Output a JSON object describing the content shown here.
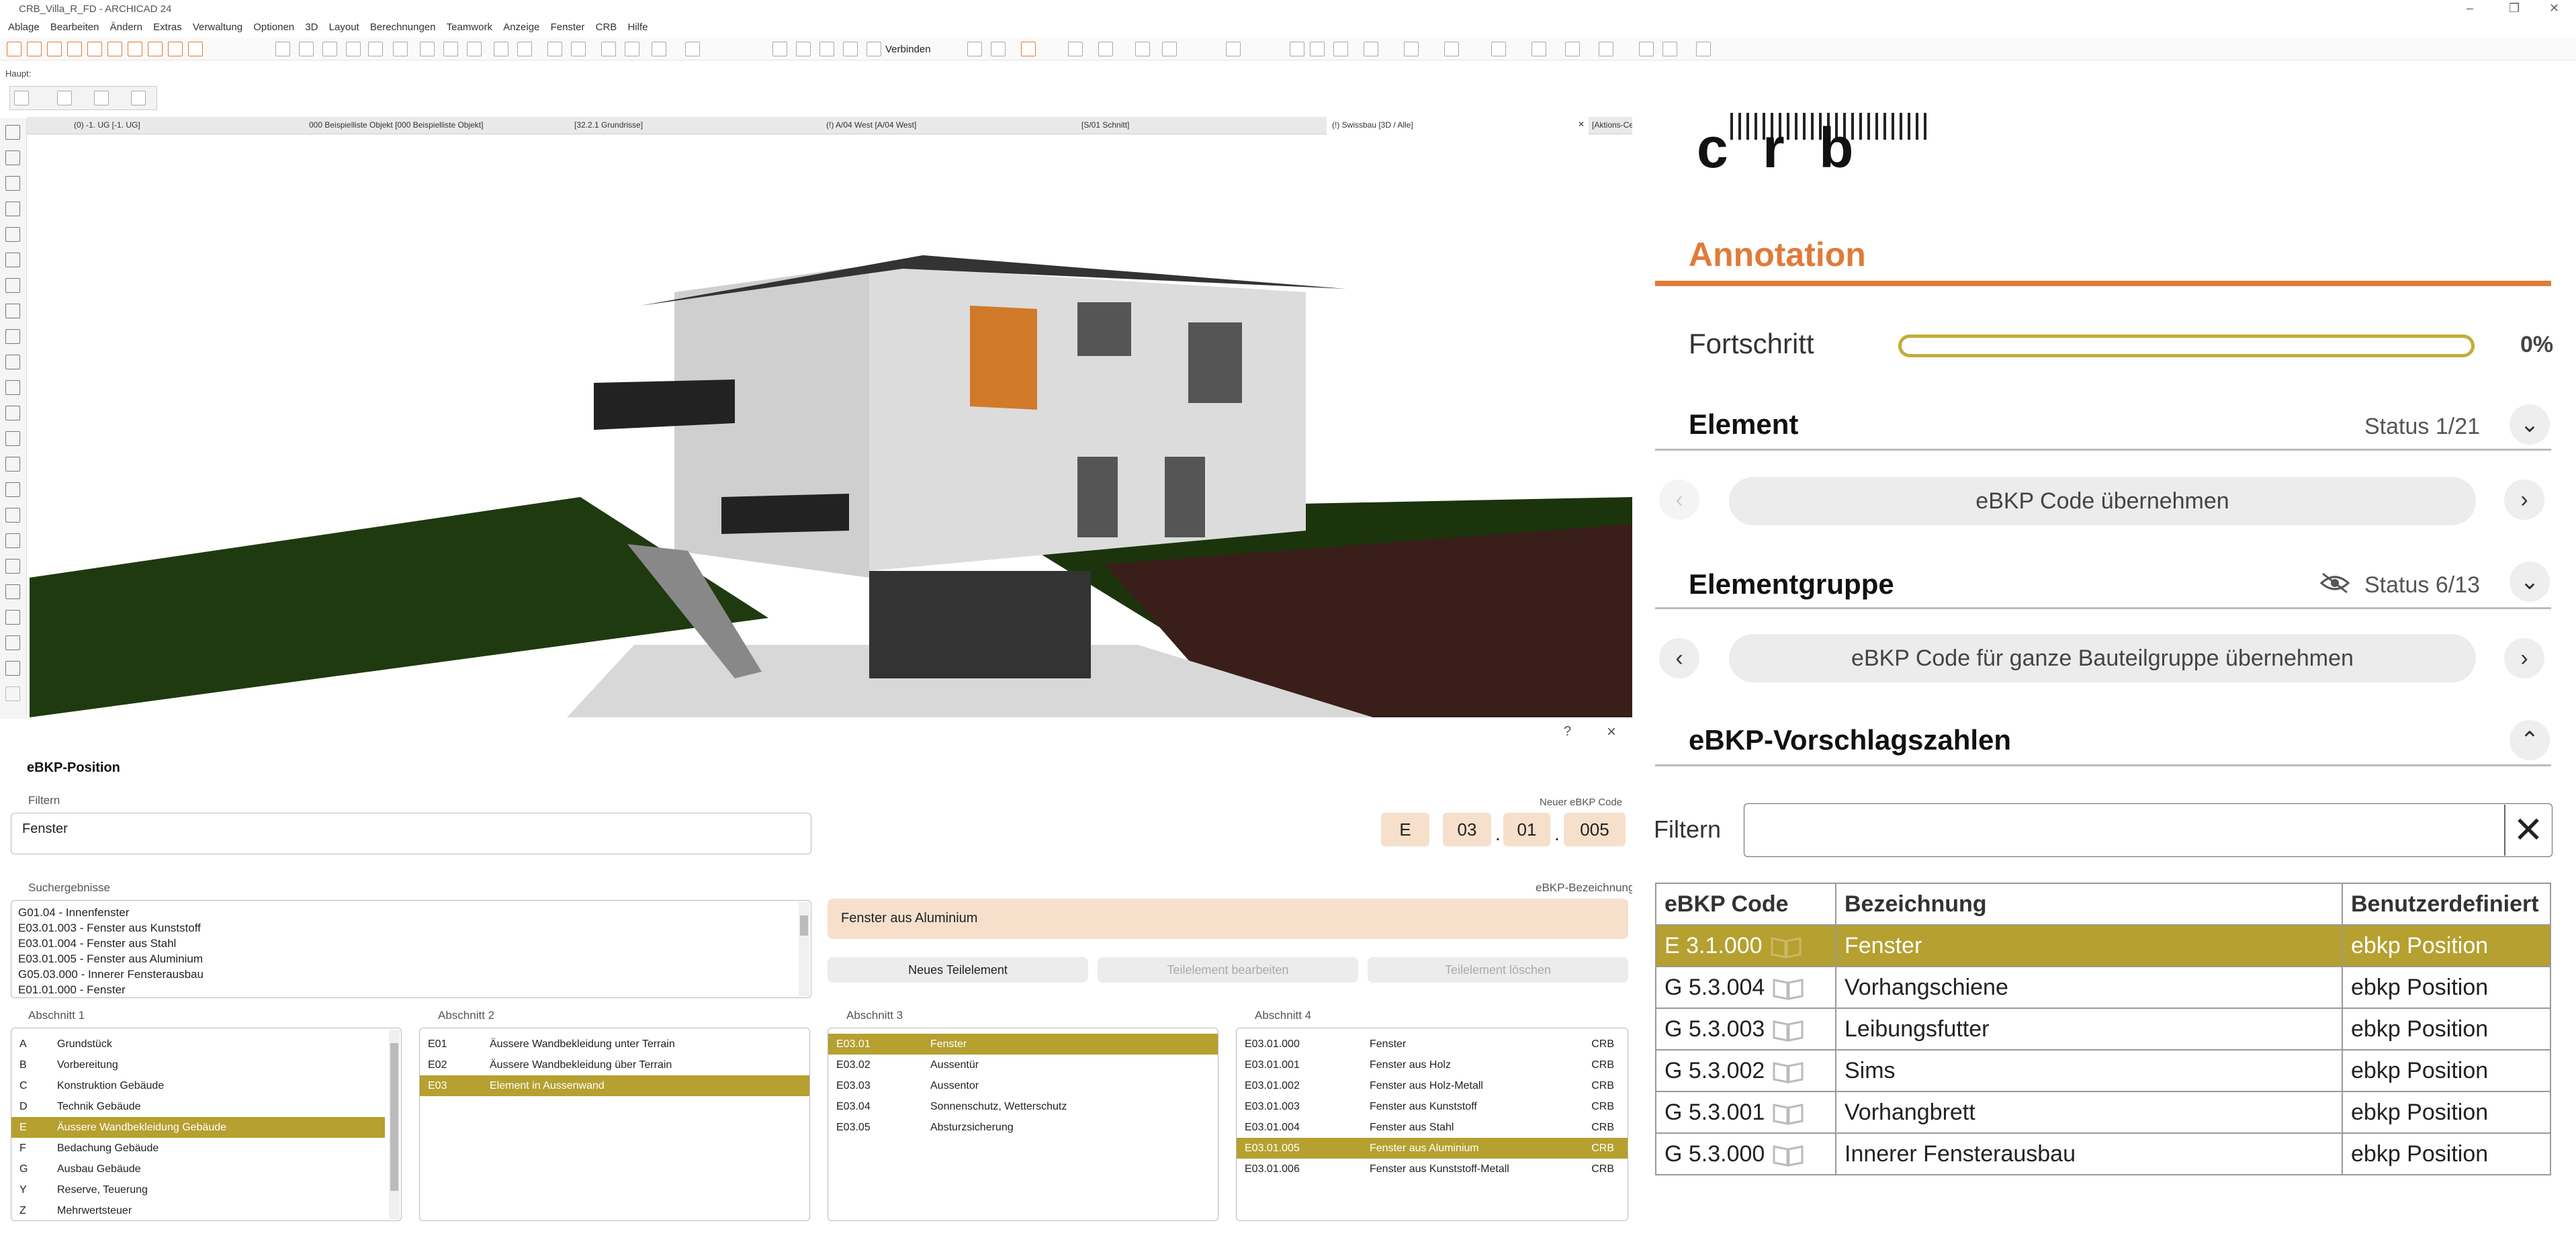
{
  "window": {
    "title": "CRB_Villa_R_FD - ARCHICAD 24"
  },
  "menu": [
    "Ablage",
    "Bearbeiten",
    "Ändern",
    "Extras",
    "Verwaltung",
    "Optionen",
    "3D",
    "Layout",
    "Berechnungen",
    "Teamwork",
    "Anzeige",
    "Fenster",
    "CRB",
    "Hilfe"
  ],
  "toolbar": {
    "verbinden_label": "Verbinden",
    "haupt_label": "Haupt:"
  },
  "tabs": [
    {
      "label": "(0) -1. UG [-1. UG]"
    },
    {
      "label": "000 Beispielliste Objekt [000 Beispielliste Objekt]"
    },
    {
      "label": "[32.2.1 Grundrisse]"
    },
    {
      "label": "(!) A/04 West [A/04 West]"
    },
    {
      "label": "[S/01 Schnitt]"
    },
    {
      "label": "(!) Swissbau [3D / Alle]"
    },
    {
      "label": "[Aktions-Cen"
    }
  ],
  "panel": {
    "help_label": "?",
    "close_label": "×",
    "title": "eBKP-Position",
    "filter_label": "Filtern",
    "filter_value": "Fenster",
    "new_code_label": "Neuer eBKP Code",
    "code": {
      "p1": "E",
      "p2": "03",
      "p3": "01",
      "p4": "005",
      "sep": "."
    },
    "results_label": "Suchergebnisse",
    "results": [
      "G01.04 - Innenfenster",
      "E03.01.003 - Fenster aus Kunststoff",
      "E03.01.004 - Fenster aus Stahl",
      "E03.01.005 - Fenster aus Aluminium",
      "G05.03.000 - Innerer Fensterausbau",
      "E01.01.000 - Fenster"
    ],
    "designation_label": "eBKP-Bezeichnung",
    "designation_value": "Fenster aus Aluminium",
    "buttons": {
      "new": "Neues Teilelement",
      "edit": "Teilelement bearbeiten",
      "delete": "Teilelement löschen"
    },
    "section1": {
      "label": "Abschnitt 1",
      "items": [
        {
          "code": "A",
          "name": "Grundstück"
        },
        {
          "code": "B",
          "name": "Vorbereitung"
        },
        {
          "code": "C",
          "name": "Konstruktion Gebäude"
        },
        {
          "code": "D",
          "name": "Technik Gebäude"
        },
        {
          "code": "E",
          "name": "Äussere Wandbekleidung Gebäude"
        },
        {
          "code": "F",
          "name": "Bedachung Gebäude"
        },
        {
          "code": "G",
          "name": "Ausbau Gebäude"
        },
        {
          "code": "Y",
          "name": "Reserve, Teuerung"
        },
        {
          "code": "Z",
          "name": "Mehrwertsteuer"
        }
      ]
    },
    "section2": {
      "label": "Abschnitt 2",
      "items": [
        {
          "code": "E01",
          "name": "Äussere Wandbekleidung unter Terrain"
        },
        {
          "code": "E02",
          "name": "Äussere Wandbekleidung über Terrain"
        },
        {
          "code": "E03",
          "name": "Element in Aussenwand"
        }
      ]
    },
    "section3": {
      "label": "Abschnitt 3",
      "items": [
        {
          "code": "E03.01",
          "name": "Fenster"
        },
        {
          "code": "E03.02",
          "name": "Aussentür"
        },
        {
          "code": "E03.03",
          "name": "Aussentor"
        },
        {
          "code": "E03.04",
          "name": "Sonnenschutz, Wetterschutz"
        },
        {
          "code": "E03.05",
          "name": "Absturzsicherung"
        }
      ]
    },
    "section4": {
      "label": "Abschnitt 4",
      "items": [
        {
          "code": "E03.01.000",
          "name": "Fenster",
          "src": "CRB"
        },
        {
          "code": "E03.01.001",
          "name": "Fenster aus Holz",
          "src": "CRB"
        },
        {
          "code": "E03.01.002",
          "name": "Fenster aus Holz-Metall",
          "src": "CRB"
        },
        {
          "code": "E03.01.003",
          "name": "Fenster aus Kunststoff",
          "src": "CRB"
        },
        {
          "code": "E03.01.004",
          "name": "Fenster aus Stahl",
          "src": "CRB"
        },
        {
          "code": "E03.01.005",
          "name": "Fenster aus Aluminium",
          "src": "CRB"
        },
        {
          "code": "E03.01.006",
          "name": "Fenster aus Kunststoff-Metall",
          "src": "CRB"
        }
      ]
    }
  },
  "right": {
    "logo_text": "c r b",
    "annotation_title": "Annotation",
    "progress_label": "Fortschritt",
    "progress_value": "0%",
    "progress_fraction": 0,
    "element_title": "Element",
    "element_status": "Status 1/21",
    "element_action": "eBKP Code übernehmen",
    "group_title": "Elementgruppe",
    "group_status": "Status 6/13",
    "group_action": "eBKP Code für ganze Bauteilgruppe übernehmen",
    "suggest_title": "eBKP-Vorschlagszahlen",
    "filter_label": "Filtern",
    "filter_value": "",
    "table_headers": [
      "eBKP Code",
      "Bezeichnung",
      "Benutzerdefiniert"
    ],
    "table_rows": [
      {
        "code": "E 3.1.000",
        "name": "Fenster",
        "user": "ebkp Position"
      },
      {
        "code": "G 5.3.004",
        "name": "Vorhangschiene",
        "user": "ebkp Position"
      },
      {
        "code": "G 5.3.003",
        "name": "Leibungsfutter",
        "user": "ebkp Position"
      },
      {
        "code": "G 5.3.002",
        "name": "Sims",
        "user": "ebkp Position"
      },
      {
        "code": "G 5.3.001",
        "name": "Vorhangbrett",
        "user": "ebkp Position"
      },
      {
        "code": "G 5.3.000",
        "name": "Innerer Fensterausbau",
        "user": "ebkp Position"
      }
    ]
  },
  "colors": {
    "accent_orange": "#e07b39",
    "gold": "#b5a030",
    "progress_border": "#c3ad3a"
  }
}
